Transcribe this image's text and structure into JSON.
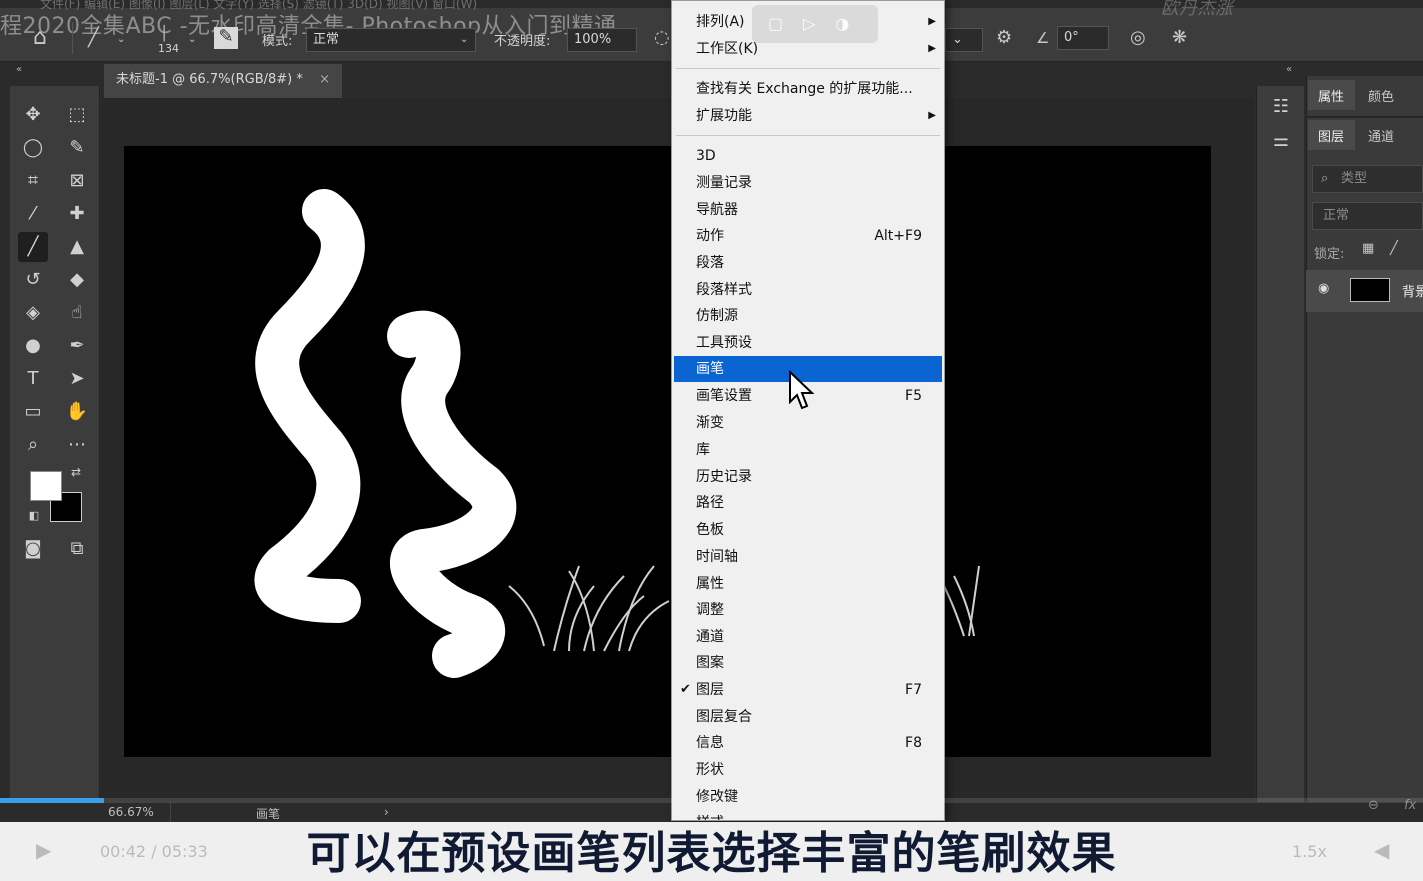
{
  "window": {
    "menu_ghost": "文件(F)   编辑(E)   图像(I)   图层(L)   文字(Y)   选择(S)   滤镜(T)   3D(D)   视图(V)   窗口(W)",
    "watermark": "程2020全集ABC -无水印高清全集- Photoshop从入门到精通",
    "watermark_right": "欧丹杰涨"
  },
  "options_bar": {
    "brush_size": "134",
    "mode_label": "模式:",
    "mode_value": "正常",
    "opacity_label": "不透明度:",
    "opacity_value": "100%",
    "angle_value": "0°"
  },
  "document_tab": {
    "title": "未标题-1 @ 66.7%(RGB/8#) *",
    "close": "×"
  },
  "status_bar": {
    "zoom": "66.67%",
    "tool": "画笔",
    "arrow": "›"
  },
  "right_panel": {
    "tabs_top": [
      "属性",
      "颜色"
    ],
    "tabs_layers": [
      "图层",
      "通道"
    ],
    "search_placeholder": "类型",
    "blend_mode": "正常",
    "lock_label": "锁定:",
    "layer_name": "背景"
  },
  "window_menu": {
    "items": [
      {
        "label": "排列(A)",
        "submenu": true
      },
      {
        "label": "工作区(K)",
        "submenu": true
      },
      {
        "label": "查找有关 Exchange 的扩展功能..."
      },
      {
        "label": "扩展功能",
        "submenu": true
      },
      {
        "label": "3D"
      },
      {
        "label": "测量记录"
      },
      {
        "label": "导航器"
      },
      {
        "label": "动作",
        "shortcut": "Alt+F9"
      },
      {
        "label": "段落"
      },
      {
        "label": "段落样式"
      },
      {
        "label": "仿制源"
      },
      {
        "label": "工具预设"
      },
      {
        "label": "画笔",
        "highlighted": true
      },
      {
        "label": "画笔设置",
        "shortcut": "F5"
      },
      {
        "label": "渐变"
      },
      {
        "label": "库"
      },
      {
        "label": "历史记录"
      },
      {
        "label": "路径"
      },
      {
        "label": "色板"
      },
      {
        "label": "时间轴"
      },
      {
        "label": "属性"
      },
      {
        "label": "调整"
      },
      {
        "label": "通道"
      },
      {
        "label": "图案"
      },
      {
        "label": "图层",
        "shortcut": "F7",
        "checked": true
      },
      {
        "label": "图层复合"
      },
      {
        "label": "信息",
        "shortcut": "F8"
      },
      {
        "label": "形状"
      },
      {
        "label": "修改键"
      },
      {
        "label": "样式"
      }
    ]
  },
  "video": {
    "time": "00:42 / 05:33",
    "speed": "1.5x",
    "subtitle": "可以在预设画笔列表选择丰富的笔刷效果"
  },
  "colors": {
    "menu_highlight": "#0a64d2",
    "panel_bg": "#3c3c3c",
    "progress": "#3aa0e8"
  }
}
